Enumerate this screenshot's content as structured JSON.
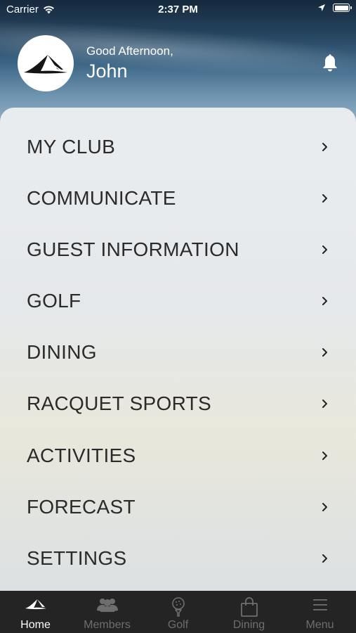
{
  "status_bar": {
    "carrier": "Carrier",
    "time": "2:37 PM"
  },
  "header": {
    "greeting": "Good Afternoon,",
    "user_name": "John",
    "logo_icon": "club-logo-icon",
    "notification_icon": "bell-icon"
  },
  "menu": {
    "items": [
      {
        "label": "MY CLUB"
      },
      {
        "label": "COMMUNICATE"
      },
      {
        "label": "GUEST INFORMATION"
      },
      {
        "label": "GOLF"
      },
      {
        "label": "DINING"
      },
      {
        "label": "RACQUET SPORTS"
      },
      {
        "label": "ACTIVITIES"
      },
      {
        "label": "FORECAST"
      },
      {
        "label": "SETTINGS"
      }
    ]
  },
  "tab_bar": {
    "active": "Home",
    "tabs": [
      {
        "label": "Home",
        "icon": "club-logo-icon"
      },
      {
        "label": "Members",
        "icon": "members-icon"
      },
      {
        "label": "Golf",
        "icon": "golf-ball-icon"
      },
      {
        "label": "Dining",
        "icon": "shopping-bag-icon"
      },
      {
        "label": "Menu",
        "icon": "hamburger-menu-icon"
      }
    ]
  },
  "colors": {
    "tab_bar_background": "#242424",
    "tab_active": "#ffffff",
    "tab_inactive": "#6e6e6e",
    "menu_text": "#2b2b2b"
  }
}
